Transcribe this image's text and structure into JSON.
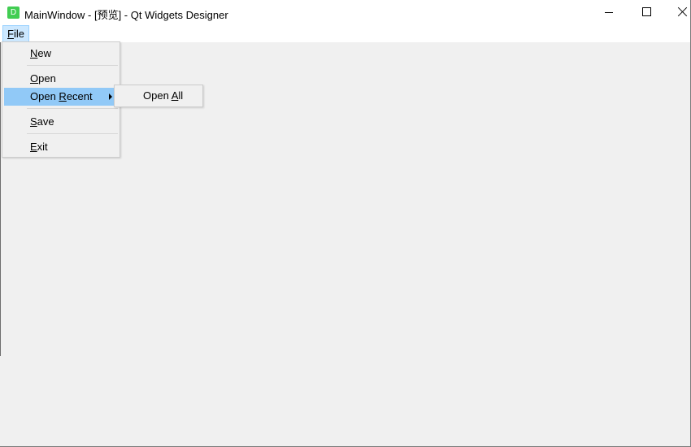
{
  "window": {
    "title": "MainWindow - [预览] - Qt Widgets Designer",
    "icon": "qt-designer-icon",
    "icon_glyph": "D",
    "icon_color": "#41cd52",
    "controls": {
      "minimize": "minimize-icon",
      "maximize": "maximize-icon",
      "close": "close-icon"
    }
  },
  "menubar": {
    "file": {
      "mnemonic": "F",
      "rest": "ile",
      "highlight_color": "#cce8ff"
    }
  },
  "file_menu": {
    "highlight_color": "#91c9f7",
    "items": [
      {
        "mnemonic": "N",
        "rest": "ew"
      },
      {
        "mnemonic": "O",
        "rest": "pen"
      },
      {
        "before": "Open ",
        "mnemonic": "R",
        "rest": "ecent",
        "has_submenu": true
      },
      {
        "mnemonic": "S",
        "rest": "ave"
      },
      {
        "mnemonic": "E",
        "rest": "xit"
      }
    ]
  },
  "open_recent_submenu": {
    "items": [
      {
        "before": "Open ",
        "mnemonic": "A",
        "rest": "ll"
      }
    ]
  }
}
